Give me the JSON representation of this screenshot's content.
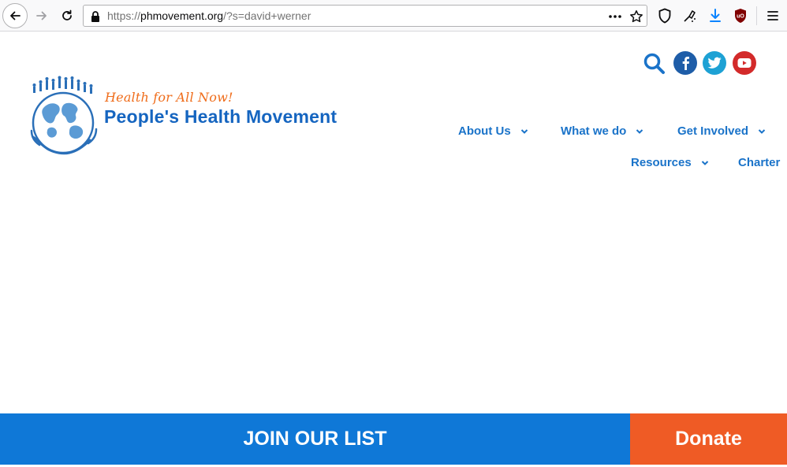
{
  "browser": {
    "url_prefix": "https://",
    "url_host": "phmovement.org",
    "url_path": "/?s=david+werner"
  },
  "header": {
    "tagline": "Health for All Now!",
    "org_name": "People's Health Movement"
  },
  "nav": {
    "items": [
      {
        "label": "About Us"
      },
      {
        "label": "What we do"
      },
      {
        "label": "Get Involved"
      },
      {
        "label": "Resources"
      },
      {
        "label": "Charter"
      }
    ]
  },
  "social": {
    "icons": [
      "search-icon",
      "facebook-icon",
      "twitter-icon",
      "youtube-icon"
    ]
  },
  "footer": {
    "join_label": "JOIN OUR LIST",
    "donate_label": "Donate"
  },
  "colors": {
    "brand_blue": "#1565c0",
    "nav_blue": "#1a73c9",
    "join_blue": "#0f78d7",
    "donate_orange": "#ef5b25",
    "tagline_orange": "#ef6c1a"
  }
}
